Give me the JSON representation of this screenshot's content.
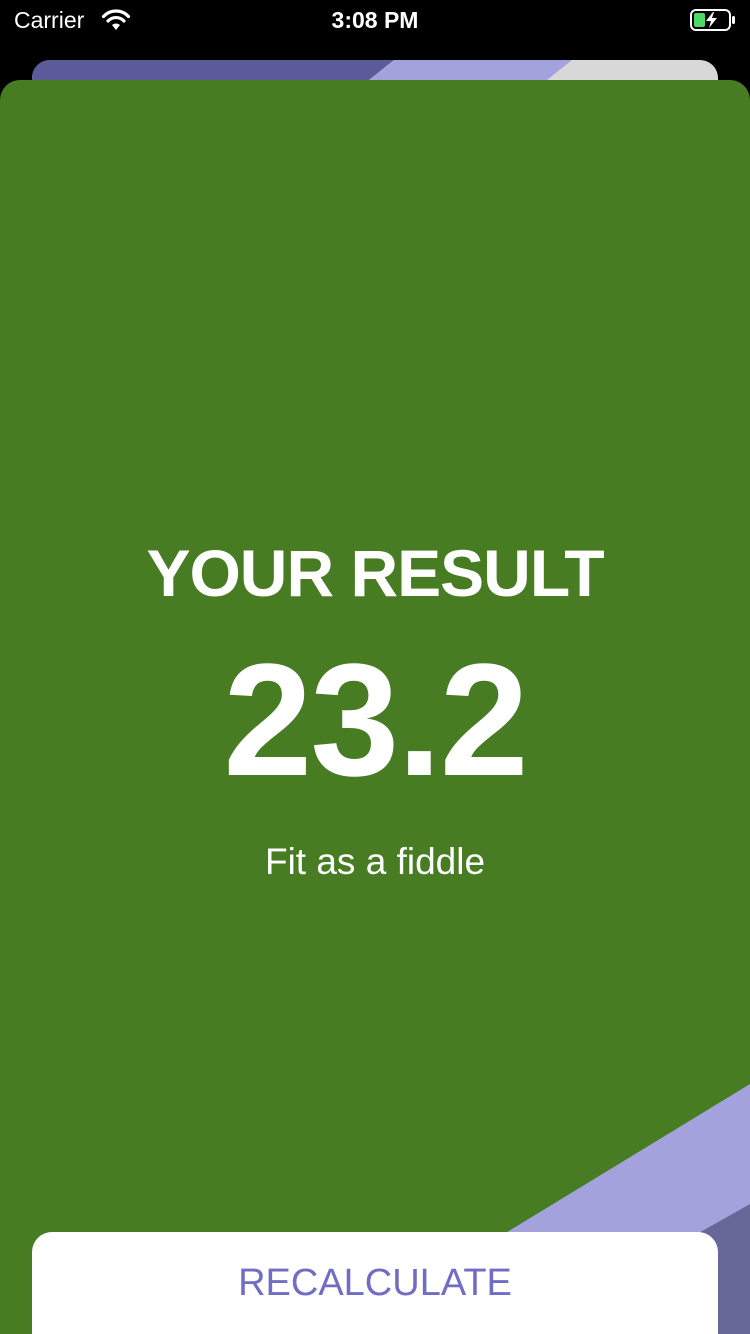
{
  "status_bar": {
    "carrier": "Carrier",
    "time": "3:08 PM",
    "wifi_icon": "wifi-icon",
    "battery_icon": "battery-charging-icon"
  },
  "result": {
    "title": "YOUR RESULT",
    "value": "23.2",
    "message": "Fit as a fiddle"
  },
  "actions": {
    "recalculate_label": "RECALCULATE"
  },
  "colors": {
    "card_background": "#477c23",
    "accent_dark": "#5b5b9a",
    "accent_light": "#a4a2dc",
    "button_text": "#6f6dc4",
    "button_background": "#ffffff"
  }
}
